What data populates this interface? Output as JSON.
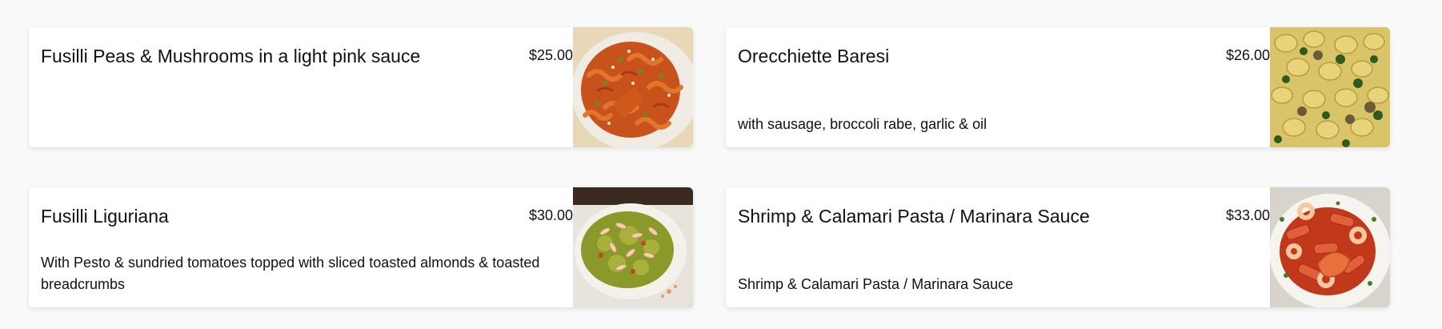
{
  "menu": {
    "items": [
      {
        "title": "Fusilli Peas & Mushrooms in a light pink sauce",
        "price": "$25.00",
        "description": "",
        "image": "fusilli-pink-sauce-photo"
      },
      {
        "title": "Orecchiette Baresi",
        "price": "$26.00",
        "description": "with sausage, broccoli rabe, garlic & oil",
        "image": "orecchiette-photo"
      },
      {
        "title": "Fusilli Liguriana",
        "price": "$30.00",
        "description": "With Pesto & sundried tomatoes topped with sliced toasted almonds & toasted breadcrumbs",
        "image": "pesto-pasta-photo"
      },
      {
        "title": "Shrimp & Calamari Pasta / Marinara Sauce",
        "price": "$33.00",
        "description": "Shrimp & Calamari Pasta / Marinara Sauce",
        "image": "shrimp-calamari-photo"
      }
    ]
  },
  "colors": {
    "page_background": "#f9f9f9",
    "card_background": "#ffffff",
    "text": "#111111"
  }
}
